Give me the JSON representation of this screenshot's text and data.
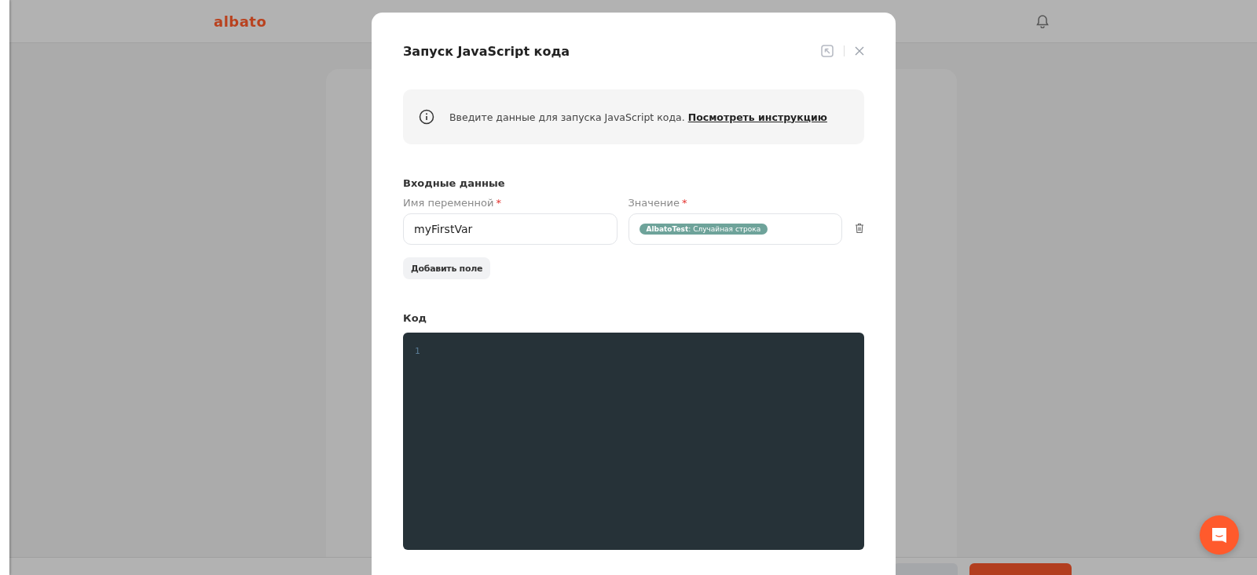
{
  "header": {
    "logo": "albato"
  },
  "dialog": {
    "title": "Запуск JavaScript кода",
    "info": {
      "text": "Введите данные для запуска JavaScript кода.",
      "link": "Посмотреть инструкцию"
    },
    "inputs_section": {
      "title": "Входные данные",
      "rows": [
        {
          "name_label": "Имя переменной",
          "name_required_mark": "*",
          "name_value": "myFirstVar",
          "value_label": "Значение",
          "value_required_mark": "*",
          "value_tag": "**AlbatoTest**: Случайная строка"
        }
      ],
      "add_button": "Добавить поле"
    },
    "code_section": {
      "title": "Код",
      "line_numbers": [
        "1"
      ]
    }
  }
}
